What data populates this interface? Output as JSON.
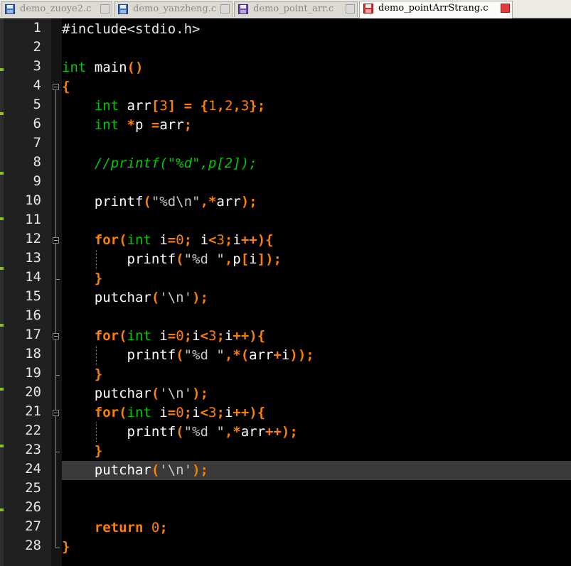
{
  "tabs": [
    {
      "label": "demo_zuoye2.c",
      "active": false,
      "icon": "floppy-disk-icon"
    },
    {
      "label": "demo_yanzheng.c",
      "active": false,
      "icon": "floppy-disk-icon"
    },
    {
      "label": "demo_point_arr.c",
      "active": false,
      "icon": "floppy-disk-icon"
    },
    {
      "label": "demo_pointArrStrang.c",
      "active": true,
      "icon": "floppy-disk-icon"
    }
  ],
  "editor": {
    "current_line": 24,
    "colors": {
      "background": "#000000",
      "keyword": "#ff8000",
      "type": "#00c800",
      "number": "#ff8000",
      "comment": "#00c800",
      "current_line": "#3a3a3a"
    },
    "lines": [
      [
        [
          "pp",
          "#include<stdio.h>"
        ]
      ],
      [],
      [
        [
          "t",
          "int"
        ],
        [
          "x",
          " main"
        ],
        [
          "p",
          "()"
        ]
      ],
      [
        [
          "p",
          "{"
        ]
      ],
      [
        [
          "x",
          "    "
        ],
        [
          "t",
          "int"
        ],
        [
          "x",
          " arr"
        ],
        [
          "p",
          "["
        ],
        [
          "n",
          "3"
        ],
        [
          "p",
          "]"
        ],
        [
          "x",
          " "
        ],
        [
          "p",
          "="
        ],
        [
          "x",
          " "
        ],
        [
          "p",
          "{"
        ],
        [
          "n",
          "1"
        ],
        [
          "p",
          ","
        ],
        [
          "n",
          "2"
        ],
        [
          "p",
          ","
        ],
        [
          "n",
          "3"
        ],
        [
          "p",
          "};"
        ]
      ],
      [
        [
          "x",
          "    "
        ],
        [
          "t",
          "int"
        ],
        [
          "x",
          " "
        ],
        [
          "p",
          "*"
        ],
        [
          "x",
          "p "
        ],
        [
          "p",
          "="
        ],
        [
          "x",
          "arr"
        ],
        [
          "p",
          ";"
        ]
      ],
      [],
      [
        [
          "x",
          "    "
        ],
        [
          "c",
          "//printf(\"%d\",p[2]);"
        ]
      ],
      [],
      [
        [
          "x",
          "    printf"
        ],
        [
          "p",
          "("
        ],
        [
          "s",
          "\"%d\\n\""
        ],
        [
          "p",
          ",*"
        ],
        [
          "x",
          "arr"
        ],
        [
          "p",
          ");"
        ]
      ],
      [],
      [
        [
          "x",
          "    "
        ],
        [
          "k",
          "for"
        ],
        [
          "p",
          "("
        ],
        [
          "t",
          "int"
        ],
        [
          "x",
          " i"
        ],
        [
          "p",
          "="
        ],
        [
          "n",
          "0"
        ],
        [
          "p",
          ";"
        ],
        [
          "x",
          " i"
        ],
        [
          "p",
          "<"
        ],
        [
          "n",
          "3"
        ],
        [
          "p",
          ";"
        ],
        [
          "x",
          "i"
        ],
        [
          "p",
          "++){"
        ]
      ],
      [
        [
          "x",
          "        printf"
        ],
        [
          "p",
          "("
        ],
        [
          "s",
          "\"%d \""
        ],
        [
          "p",
          ","
        ],
        [
          "x",
          "p"
        ],
        [
          "p",
          "["
        ],
        [
          "x",
          "i"
        ],
        [
          "p",
          "]);"
        ]
      ],
      [
        [
          "x",
          "    "
        ],
        [
          "p",
          "}"
        ]
      ],
      [
        [
          "x",
          "    putchar"
        ],
        [
          "p",
          "("
        ],
        [
          "s",
          "'\\n'"
        ],
        [
          "p",
          ");"
        ]
      ],
      [],
      [
        [
          "x",
          "    "
        ],
        [
          "k",
          "for"
        ],
        [
          "p",
          "("
        ],
        [
          "t",
          "int"
        ],
        [
          "x",
          " i"
        ],
        [
          "p",
          "="
        ],
        [
          "n",
          "0"
        ],
        [
          "p",
          ";"
        ],
        [
          "x",
          "i"
        ],
        [
          "p",
          "<"
        ],
        [
          "n",
          "3"
        ],
        [
          "p",
          ";"
        ],
        [
          "x",
          "i"
        ],
        [
          "p",
          "++){"
        ]
      ],
      [
        [
          "x",
          "        printf"
        ],
        [
          "p",
          "("
        ],
        [
          "s",
          "\"%d \""
        ],
        [
          "p",
          ",*("
        ],
        [
          "x",
          "arr"
        ],
        [
          "p",
          "+"
        ],
        [
          "x",
          "i"
        ],
        [
          "p",
          "));"
        ]
      ],
      [
        [
          "x",
          "    "
        ],
        [
          "p",
          "}"
        ]
      ],
      [
        [
          "x",
          "    putchar"
        ],
        [
          "p",
          "("
        ],
        [
          "s",
          "'\\n'"
        ],
        [
          "p",
          ");"
        ]
      ],
      [
        [
          "x",
          "    "
        ],
        [
          "k",
          "for"
        ],
        [
          "p",
          "("
        ],
        [
          "t",
          "int"
        ],
        [
          "x",
          " i"
        ],
        [
          "p",
          "="
        ],
        [
          "n",
          "0"
        ],
        [
          "p",
          ";"
        ],
        [
          "x",
          "i"
        ],
        [
          "p",
          "<"
        ],
        [
          "n",
          "3"
        ],
        [
          "p",
          ";"
        ],
        [
          "x",
          "i"
        ],
        [
          "p",
          "++){"
        ]
      ],
      [
        [
          "x",
          "        printf"
        ],
        [
          "p",
          "("
        ],
        [
          "s",
          "\"%d \""
        ],
        [
          "p",
          ",*"
        ],
        [
          "x",
          "arr"
        ],
        [
          "p",
          "++);"
        ]
      ],
      [
        [
          "x",
          "    "
        ],
        [
          "p",
          "}"
        ]
      ],
      [
        [
          "x",
          "    putchar"
        ],
        [
          "p",
          "("
        ],
        [
          "s",
          "'\\n'"
        ],
        [
          "p",
          ");"
        ]
      ],
      [],
      [],
      [
        [
          "x",
          "    "
        ],
        [
          "k",
          "return"
        ],
        [
          "x",
          " "
        ],
        [
          "n",
          "0"
        ],
        [
          "p",
          ";"
        ]
      ],
      [
        [
          "p",
          "}"
        ]
      ]
    ]
  }
}
